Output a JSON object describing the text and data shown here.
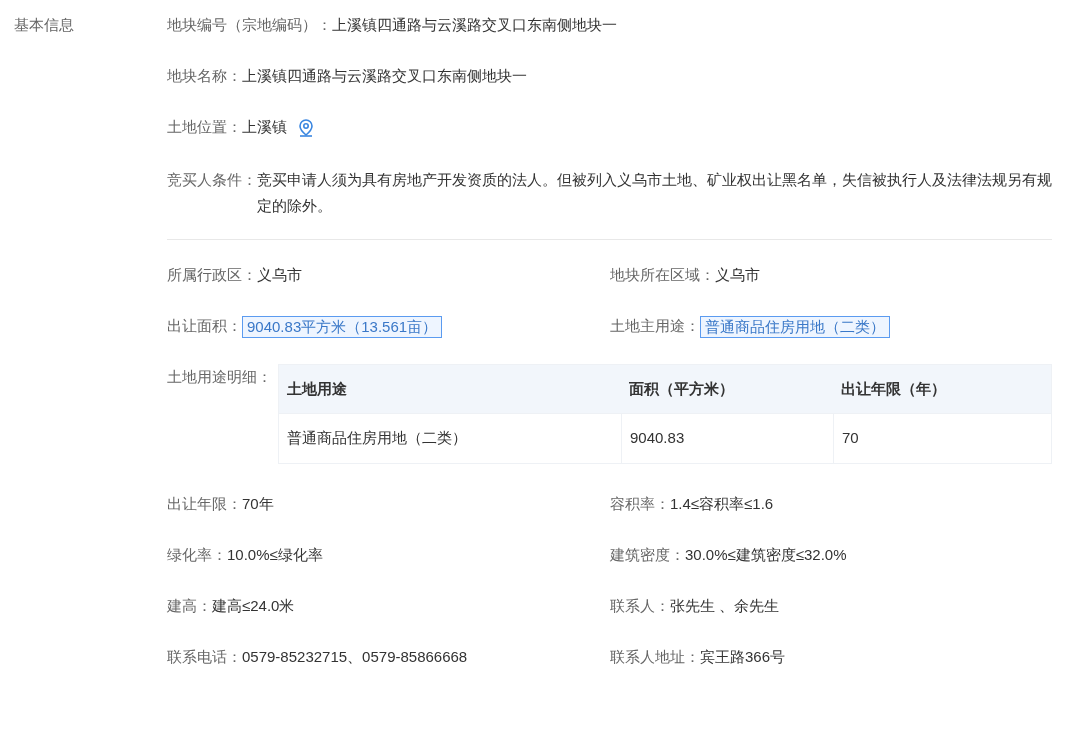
{
  "section_title": "基本信息",
  "top_fields": [
    {
      "kind": "text",
      "label": "地块编号（宗地编码）：",
      "value": "上溪镇四通路与云溪路交叉口东南侧地块一"
    },
    {
      "kind": "text",
      "label": "地块名称：",
      "value": "上溪镇四通路与云溪路交叉口东南侧地块一"
    },
    {
      "kind": "location",
      "label": "土地位置：",
      "value": "上溪镇"
    },
    {
      "kind": "text",
      "label": "竞买人条件：",
      "value": "竞买申请人须为具有房地产开发资质的法人。但被列入义乌市土地、矿业权出让黑名单，失信被执行人及法律法规另有规定的除外。"
    }
  ],
  "grid_fields_1": [
    {
      "label": "所属行政区：",
      "value": "义乌市",
      "highlighted": false
    },
    {
      "label": "地块所在区域：",
      "value": "义乌市",
      "highlighted": false
    },
    {
      "label": "出让面积：",
      "value": "9040.83平方米（13.561亩）",
      "highlighted": true
    },
    {
      "label": "土地主用途：",
      "value": "普通商品住房用地（二类）",
      "highlighted": true
    }
  ],
  "usage_table": {
    "label": "土地用途明细：",
    "columns": [
      "土地用途",
      "面积（平方米）",
      "出让年限（年）"
    ],
    "rows": [
      [
        "普通商品住房用地（二类）",
        "9040.83",
        "70"
      ]
    ]
  },
  "grid_fields_2": [
    {
      "label": "出让年限：",
      "value": "70年",
      "highlighted": false
    },
    {
      "label": "容积率：",
      "value": "1.4≤容积率≤1.6",
      "highlighted": false
    },
    {
      "label": "绿化率：",
      "value": "10.0%≤绿化率",
      "highlighted": false
    },
    {
      "label": "建筑密度：",
      "value": "30.0%≤建筑密度≤32.0%",
      "highlighted": false
    },
    {
      "label": "建高：",
      "value": "建高≤24.0米",
      "highlighted": false
    },
    {
      "label": "联系人：",
      "value": "张先生 、余先生",
      "highlighted": false
    },
    {
      "label": "联系电话：",
      "value": "0579-85232715、0579-85866668",
      "highlighted": false
    },
    {
      "label": "联系人地址：",
      "value": "宾王路366号",
      "highlighted": false
    }
  ]
}
